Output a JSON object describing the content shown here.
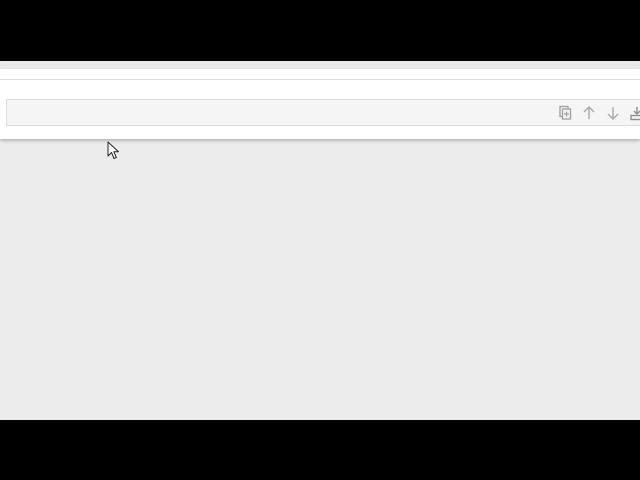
{
  "colors": {
    "letterbox": "#000000",
    "workspace": "#ececec",
    "panel": "#ffffff",
    "cell_background": "#f5f5f5",
    "cell_border": "#d9dde1",
    "icon": "#9e9e9e"
  },
  "cell": {
    "value": "",
    "placeholder": ""
  },
  "toolbar": {
    "icons": [
      "duplicate-icon",
      "arrow-up-icon",
      "arrow-down-icon",
      "insert-below-icon"
    ]
  }
}
